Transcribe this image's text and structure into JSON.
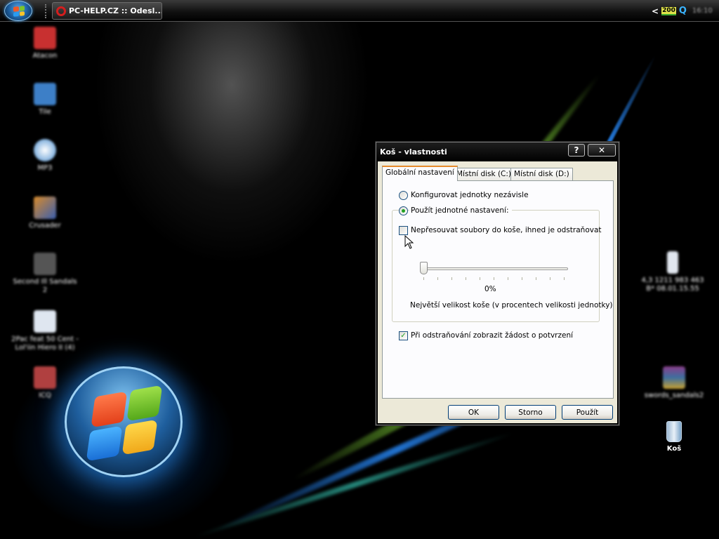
{
  "taskbar": {
    "task_label": "PC-HELP.CZ :: Odesl...",
    "tray_badge": "200",
    "tray_arrow": "<",
    "tray_q": "Q",
    "clock": "16:10"
  },
  "desktop_icons": [
    {
      "label": "Atacon",
      "color": "#c83030"
    },
    {
      "label": "Tile",
      "color": "#3d7fc7"
    },
    {
      "label": "MP3",
      "color": "#4c8fd0"
    },
    {
      "label": "Crusader",
      "color": "#d88a2a"
    },
    {
      "label": "Second Ill Sandals 2",
      "color": "#555555"
    },
    {
      "label": "2Pac feat 50 Cent - Lol'iin Hiero II (4)",
      "color": "#dfe6f0"
    },
    {
      "label": "ICQ",
      "color": "#b04040"
    },
    {
      "label": "4,3 1211 983 463 B* 08.01.15.55",
      "color": "#e0e6ee"
    },
    {
      "label": "swords_sandals2",
      "color": "#8a3d8a"
    },
    {
      "label": "Koš",
      "color": "#7aa3c8"
    }
  ],
  "dialog": {
    "title": "Koš - vlastnosti",
    "help_label": "?",
    "close_label": "✕",
    "tabs": [
      "Globální nastavení",
      "Místní disk (C:)",
      "Místní disk (D:)"
    ],
    "radio_independent": "Konfigurovat jednotky nezávisle",
    "radio_uniform": "Použít jednotné nastavení:",
    "checkbox_no_recycle": "Nepřesouvat soubory do koše, ihned je odstraňovat",
    "slider_value": "0%",
    "slider_fraction": 0,
    "slider_caption": "Největší velikost koše (v procentech velikosti jednotky)",
    "checkbox_confirm": "Při odstraňování zobrazit žádost o potvrzení",
    "checkbox_confirm_mark": "✓",
    "ok_label": "OK",
    "cancel_label": "Storno",
    "apply_label": "Použít"
  },
  "colors": {
    "accent_tab": "#e68b2c",
    "radio_dot": "#21a121",
    "orb_blue": "#1f5f9e"
  },
  "icons": [
    "windows-start-icon",
    "opera-icon",
    "quicktime-icon",
    "recycle-bin-icon",
    "mouse-cursor-icon"
  ]
}
